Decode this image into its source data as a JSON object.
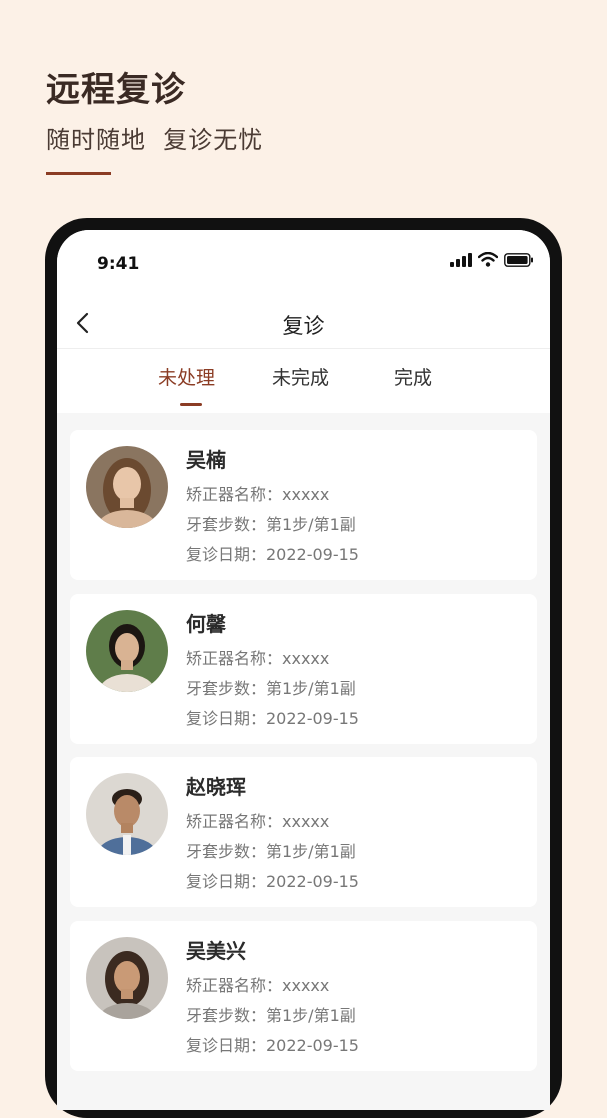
{
  "promo": {
    "title": "远程复诊",
    "subtitle": "随时随地  复诊无忧"
  },
  "status_bar": {
    "time": "9:41"
  },
  "nav": {
    "title": "复诊",
    "back_icon": "chevron-left-icon"
  },
  "tabs": [
    {
      "label": "未处理",
      "active": true
    },
    {
      "label": "未完成",
      "active": false
    },
    {
      "label": "完成",
      "active": false
    }
  ],
  "colors": {
    "accent": "#8b3c24",
    "background": "#fcf1e7"
  },
  "patients": [
    {
      "name": "吴楠",
      "appliance": "矫正器名称：xxxxx",
      "steps": "牙套步数：第1步/第1副",
      "date": "复诊日期：2022-09-15"
    },
    {
      "name": "何馨",
      "appliance": "矫正器名称：xxxxx",
      "steps": "牙套步数：第1步/第1副",
      "date": "复诊日期：2022-09-15"
    },
    {
      "name": "赵晓珲",
      "appliance": "矫正器名称：xxxxx",
      "steps": "牙套步数：第1步/第1副",
      "date": "复诊日期：2022-09-15"
    },
    {
      "name": "吴美兴",
      "appliance": "矫正器名称：xxxxx",
      "steps": "牙套步数：第1步/第1副",
      "date": "复诊日期：2022-09-15"
    }
  ]
}
